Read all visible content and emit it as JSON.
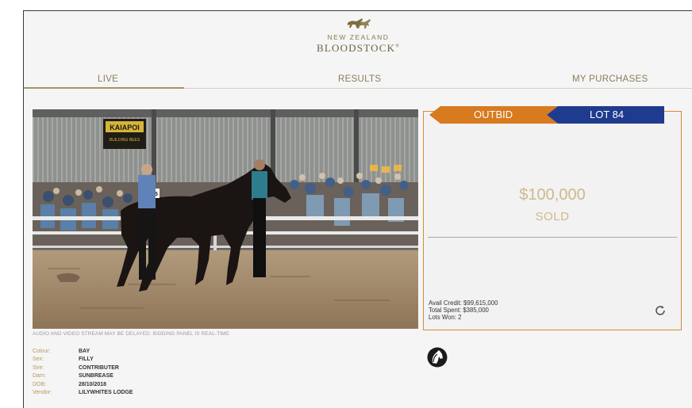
{
  "brand": {
    "line1": "NEW ZEALAND",
    "line2": "BLOODSTOCK",
    "reg": "®"
  },
  "tabs": [
    {
      "label": "LIVE",
      "active": true
    },
    {
      "label": "RESULTS",
      "active": false
    },
    {
      "label": "MY PURCHASES",
      "active": false
    }
  ],
  "video": {
    "disclaimer": "AUDIO AND VIDEO STREAM MAY BE DELAYED. BIDDING PANEL IS REAL-TIME",
    "sign_text": "KAIAPOI",
    "sign_sub": "BUILDING BEES",
    "number_cloth": "185"
  },
  "lot_details": [
    {
      "key": "Colour:",
      "value": "BAY"
    },
    {
      "key": "Sex:",
      "value": "FILLY"
    },
    {
      "key": "Sire:",
      "value": "CONTRIBUTER"
    },
    {
      "key": "Dam:",
      "value": "SUNBREASE"
    },
    {
      "key": "DOB:",
      "value": "28/10/2018"
    },
    {
      "key": "Vendor:",
      "value": "LILYWHITES LODGE"
    }
  ],
  "bid_panel": {
    "status": "OUTBID",
    "lot": "LOT 84",
    "price": "$100,000",
    "result": "SOLD",
    "avail_credit": "Avail Credit: $99,615,000",
    "total_spent": "Total Spent: $385,000",
    "lots_won": "Lots Won: 2"
  },
  "colors": {
    "outbid": "#d87a1e",
    "lot": "#1e3a8f",
    "gold": "#a69767",
    "panel_border": "#d88a35"
  },
  "icons": {
    "refresh": "refresh-icon",
    "horse": "horse-head-icon",
    "logo": "horse-logo-icon"
  }
}
